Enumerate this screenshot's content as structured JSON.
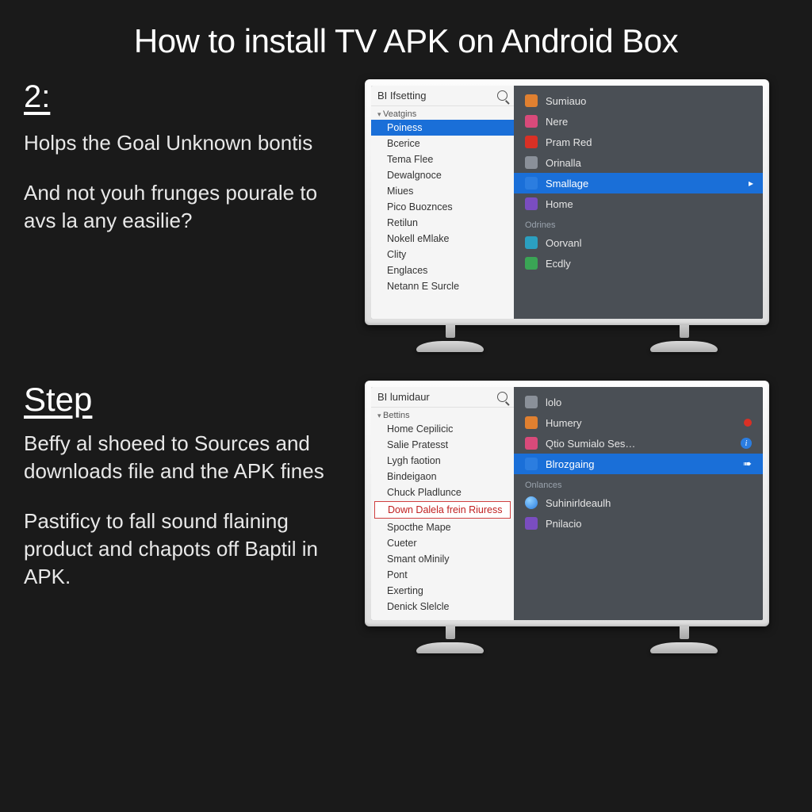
{
  "title": "How to install TV APK on Android Box",
  "step1": {
    "num": "2:",
    "p1": "Holps the Goal Unknown bontis",
    "p2": "And not youh frunges pourale to avs la any easilie?"
  },
  "step2": {
    "heading": "Step",
    "p1": "Beffy al shoeed to Sources and downloads file and the APK fines",
    "p2": "Pastificy to fall sound flaining product and chapots off Baptil in APK."
  },
  "tv1": {
    "head": "BI Ifsetting",
    "section": "Veatgins",
    "items": [
      {
        "label": "Poiness",
        "sel": true
      },
      {
        "label": "Bcerice"
      },
      {
        "label": "Tema Flee"
      },
      {
        "label": "Dewalgnoce"
      },
      {
        "label": "Miues"
      },
      {
        "label": "Pico Buoznces"
      },
      {
        "label": "Retilun"
      },
      {
        "label": "Nokell eMlake"
      },
      {
        "label": "Clity"
      },
      {
        "label": "Englaces"
      },
      {
        "label": "Netann E Surcle"
      }
    ],
    "right": [
      {
        "icon": "orange",
        "label": "Sumiauo"
      },
      {
        "icon": "pink",
        "label": "Nere"
      },
      {
        "icon": "red",
        "label": "Pram Red"
      },
      {
        "icon": "grey",
        "label": "Orinalla"
      },
      {
        "icon": "blue",
        "label": "Smallage",
        "sel": true
      },
      {
        "icon": "purple",
        "label": "Home"
      }
    ],
    "cat": "Odrines",
    "right2": [
      {
        "icon": "cyan",
        "label": "Oorvanl"
      },
      {
        "icon": "green",
        "label": "Ecdly"
      }
    ]
  },
  "tv2": {
    "head": "BI lumidaur",
    "section": "Bettins",
    "items": [
      {
        "label": "Home Cepilicic"
      },
      {
        "label": "Salie Pratesst"
      },
      {
        "label": "Lygh faotion"
      },
      {
        "label": "Bindeigaon"
      },
      {
        "label": "Chuck Pladlunce"
      },
      {
        "label": "Down Dalela frein Riuress",
        "red": true
      },
      {
        "label": "Spocthe Mape"
      },
      {
        "label": "Cueter"
      },
      {
        "label": "Smant oMinily"
      },
      {
        "label": "Pont"
      },
      {
        "label": "Exerting"
      },
      {
        "label": "Denick Slelcle"
      }
    ],
    "right": [
      {
        "icon": "grey",
        "label": "lolo"
      },
      {
        "icon": "orange",
        "label": "Humery",
        "dot": true
      },
      {
        "icon": "pink",
        "label": "Qtio Sumialo Ses…",
        "info": true
      },
      {
        "icon": "blue",
        "label": "Blrozgaing",
        "sel": true,
        "chev": "➠"
      }
    ],
    "cat": "Onlances",
    "right2": [
      {
        "icon": "globe",
        "label": "Suhinirldeaulh"
      },
      {
        "icon": "purple",
        "label": "Pnilacio"
      }
    ]
  }
}
